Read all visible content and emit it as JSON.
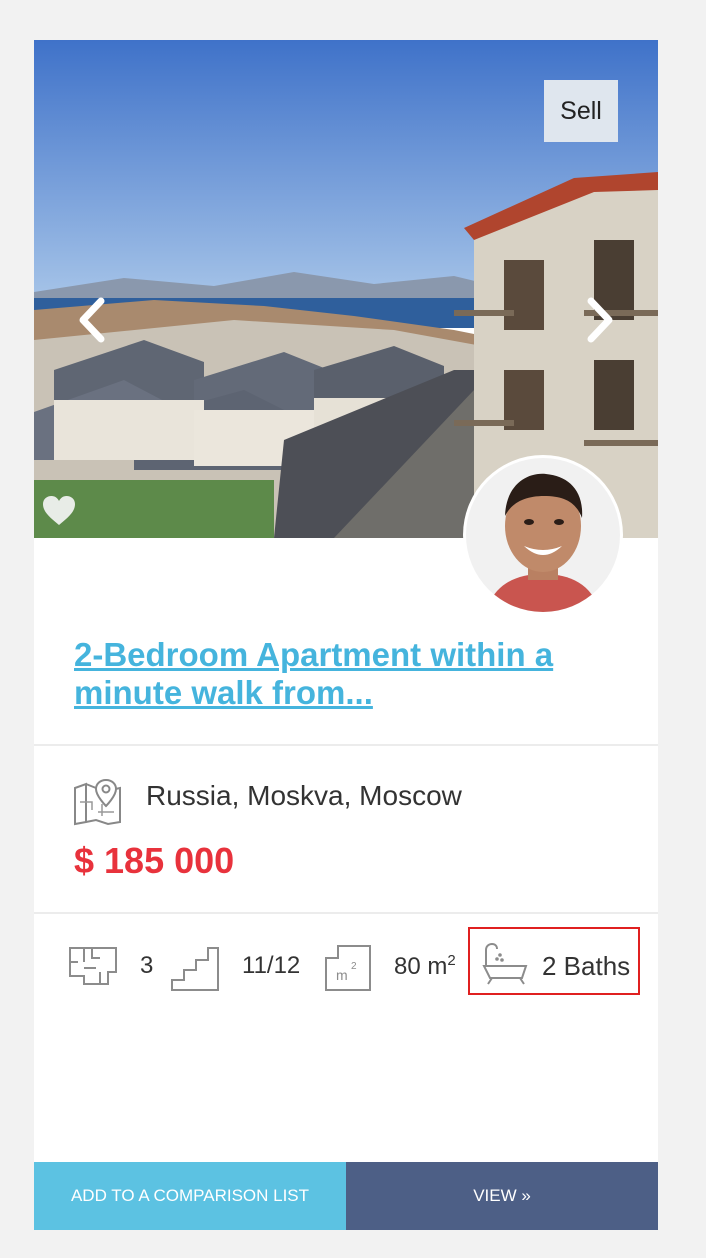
{
  "listing": {
    "badge": "Sell",
    "title": "2-Bedroom Apartment within a minute walk from...",
    "location": "Russia, Moskva, Moscow",
    "price": "$ 185 000"
  },
  "features": {
    "rooms": "3",
    "floor": "11/12",
    "area": "80 m",
    "area_sup": "2",
    "baths": "2 Baths"
  },
  "actions": {
    "compare_label": "ADD TO A COMPARISON LIST",
    "view_label": "VIEW »"
  },
  "icons": {
    "prev": "chevron-left-icon",
    "next": "chevron-right-icon",
    "favorite": "heart-icon",
    "location": "map-pin-icon",
    "rooms": "floorplan-icon",
    "floor": "stairs-icon",
    "area": "area-icon",
    "baths": "bathtub-icon"
  },
  "colors": {
    "title": "#45b4dd",
    "price": "#e8323c",
    "compare_button": "#5cc2e2",
    "view_button": "#4d5f86",
    "highlight_border": "#e02020"
  }
}
